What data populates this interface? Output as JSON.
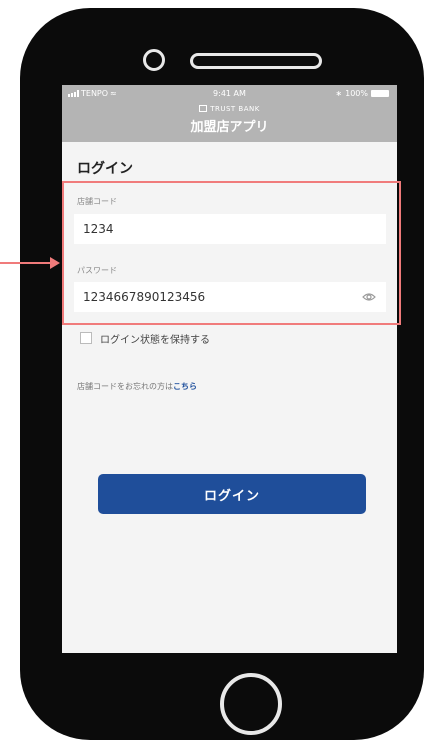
{
  "status_bar": {
    "carrier": "TENPO",
    "time": "9:41 AM",
    "battery": "100%"
  },
  "header": {
    "brand": "TRUST BANK",
    "app_title": "加盟店アプリ"
  },
  "login_form": {
    "page_title": "ログイン",
    "store_code_label": "店舗コード",
    "store_code_value": "1234",
    "password_label": "パスワード",
    "password_value": "1234667890123456",
    "keep_logged_in_label": "ログイン状態を保持する",
    "forgot_text": "店舗コードをお忘れの方は",
    "forgot_link": "こちら",
    "login_button": "ログイン"
  },
  "colors": {
    "header_bg": "#b4b4b4",
    "primary": "#1f4e9a",
    "highlight": "#f07b7b",
    "screen_bg": "#f4f4f4"
  }
}
